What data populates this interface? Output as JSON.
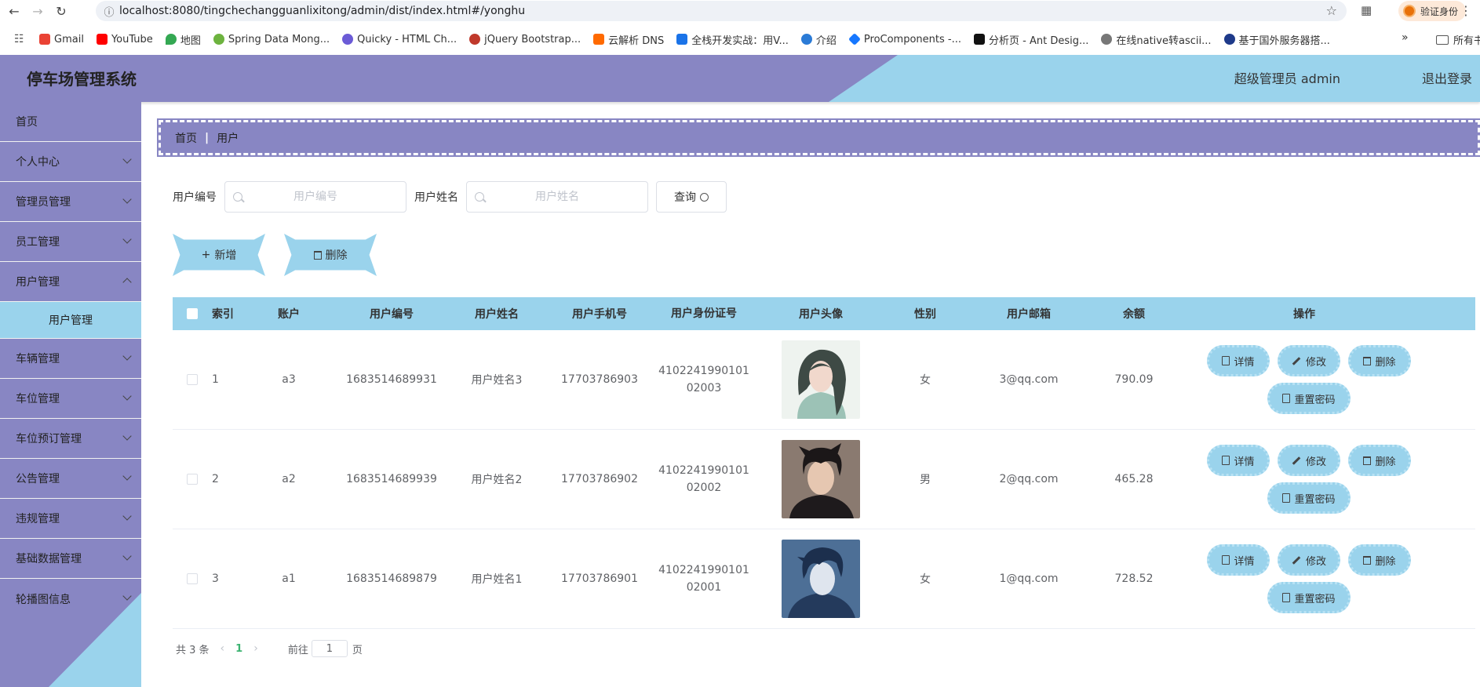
{
  "browser": {
    "url": "localhost:8080/tingchechangguanlixitong/admin/dist/index.html#/yonghu",
    "verify_label": "验证身份",
    "bookmarks": [
      "Gmail",
      "YouTube",
      "地图",
      "Spring Data Mong...",
      "Quicky - HTML Ch...",
      "jQuery Bootstrap...",
      "云解析 DNS",
      "全栈开发实战：用V...",
      "介绍",
      "ProComponents -...",
      "分析页 - Ant Desig...",
      "在线native转ascii...",
      "基于国外服务器搭..."
    ],
    "more_label": "»",
    "folder_label": "所有书"
  },
  "header": {
    "title": "停车场管理系统",
    "user": "超级管理员 admin",
    "logout": "退出登录"
  },
  "sidebar": {
    "items": [
      {
        "label": "首页"
      },
      {
        "label": "个人中心"
      },
      {
        "label": "管理员管理"
      },
      {
        "label": "员工管理"
      },
      {
        "label": "用户管理"
      },
      {
        "label": "车辆管理"
      },
      {
        "label": "车位管理"
      },
      {
        "label": "车位预订管理"
      },
      {
        "label": "公告管理"
      },
      {
        "label": "违规管理"
      },
      {
        "label": "基础数据管理"
      },
      {
        "label": "轮播图信息"
      }
    ],
    "sub_active": "用户管理"
  },
  "breadcrumb": {
    "home": "首页",
    "sep": "|",
    "current": "用户"
  },
  "search": {
    "code_label": "用户编号",
    "code_placeholder": "用户编号",
    "name_label": "用户姓名",
    "name_placeholder": "用户姓名",
    "query_button": "查询"
  },
  "actions": {
    "add": "新增",
    "delete": "删除"
  },
  "table": {
    "headers": [
      "索引",
      "账户",
      "用户编号",
      "用户姓名",
      "用户手机号",
      "用户身份证号",
      "用户头像",
      "性别",
      "用户邮箱",
      "余额",
      "操作"
    ],
    "rows": [
      {
        "index": "1",
        "account": "a3",
        "code": "1683514689931",
        "name": "用户姓名3",
        "phone": "17703786903",
        "id_line1": "4102241990101",
        "id_line2": "02003",
        "sex": "女",
        "email": "3@qq.com",
        "balance": "790.09"
      },
      {
        "index": "2",
        "account": "a2",
        "code": "1683514689939",
        "name": "用户姓名2",
        "phone": "17703786902",
        "id_line1": "4102241990101",
        "id_line2": "02002",
        "sex": "男",
        "email": "2@qq.com",
        "balance": "465.28"
      },
      {
        "index": "3",
        "account": "a1",
        "code": "1683514689879",
        "name": "用户姓名1",
        "phone": "17703786901",
        "id_line1": "4102241990101",
        "id_line2": "02001",
        "sex": "女",
        "email": "1@qq.com",
        "balance": "728.52"
      }
    ],
    "ops": {
      "detail": "详情",
      "edit": "修改",
      "delete": "删除",
      "reset": "重置密码"
    }
  },
  "pager": {
    "total": "共 3 条",
    "current": "1",
    "goto": "前往",
    "page_value": "1",
    "page_unit": "页"
  },
  "colors": {
    "primary": "#8886c3",
    "accent": "#9ad3ec"
  }
}
